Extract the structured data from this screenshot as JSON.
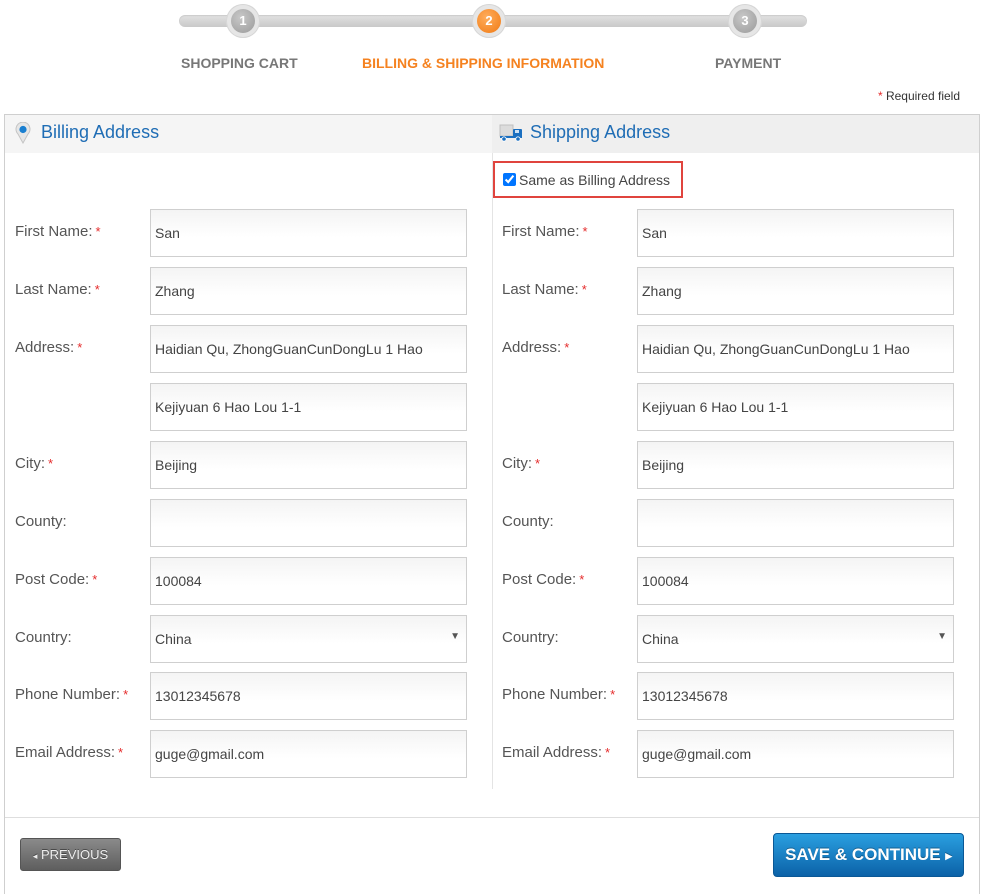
{
  "stepper": {
    "steps": [
      {
        "number": "1",
        "label": "SHOPPING CART",
        "active": false
      },
      {
        "number": "2",
        "label": "BILLING & SHIPPING INFORMATION",
        "active": true
      },
      {
        "number": "3",
        "label": "PAYMENT",
        "active": false
      }
    ]
  },
  "required_note": {
    "star": "*",
    "text": "Required field"
  },
  "billing": {
    "title": "Billing Address",
    "icon": "map-pin-icon",
    "fields": {
      "first_name": {
        "label": "First Name:",
        "required": true,
        "value": "San"
      },
      "last_name": {
        "label": "Last Name:",
        "required": true,
        "value": "Zhang"
      },
      "address": {
        "label": "Address:",
        "required": true,
        "value": "Haidian Qu, ZhongGuanCunDongLu 1 Hao",
        "value2": "Kejiyuan 6 Hao Lou 1-1"
      },
      "city": {
        "label": "City:",
        "required": true,
        "value": "Beijing"
      },
      "county": {
        "label": "County:",
        "required": false,
        "value": ""
      },
      "post_code": {
        "label": "Post Code:",
        "required": true,
        "value": "100084"
      },
      "country": {
        "label": "Country:",
        "required": false,
        "value": "China"
      },
      "phone": {
        "label": "Phone Number:",
        "required": true,
        "value": "13012345678"
      },
      "email": {
        "label": "Email Address:",
        "required": true,
        "value": "guge@gmail.com"
      }
    }
  },
  "shipping": {
    "title": "Shipping Address",
    "icon": "truck-icon",
    "same_as_billing": {
      "label": "Same as Billing Address",
      "checked": true
    },
    "fields": {
      "first_name": {
        "label": "First Name:",
        "required": true,
        "value": "San"
      },
      "last_name": {
        "label": "Last Name:",
        "required": true,
        "value": "Zhang"
      },
      "address": {
        "label": "Address:",
        "required": true,
        "value": "Haidian Qu, ZhongGuanCunDongLu 1 Hao",
        "value2": "Kejiyuan 6 Hao Lou 1-1"
      },
      "city": {
        "label": "City:",
        "required": true,
        "value": "Beijing"
      },
      "county": {
        "label": "County:",
        "required": false,
        "value": ""
      },
      "post_code": {
        "label": "Post Code:",
        "required": true,
        "value": "100084"
      },
      "country": {
        "label": "Country:",
        "required": false,
        "value": "China"
      },
      "phone": {
        "label": "Phone Number:",
        "required": true,
        "value": "13012345678"
      },
      "email": {
        "label": "Email Address:",
        "required": true,
        "value": "guge@gmail.com"
      }
    }
  },
  "buttons": {
    "previous": "PREVIOUS",
    "previous_icon": "◂",
    "save": "SAVE & CONTINUE",
    "save_icon": "▸"
  },
  "select_arrow": "▼",
  "star": "*"
}
